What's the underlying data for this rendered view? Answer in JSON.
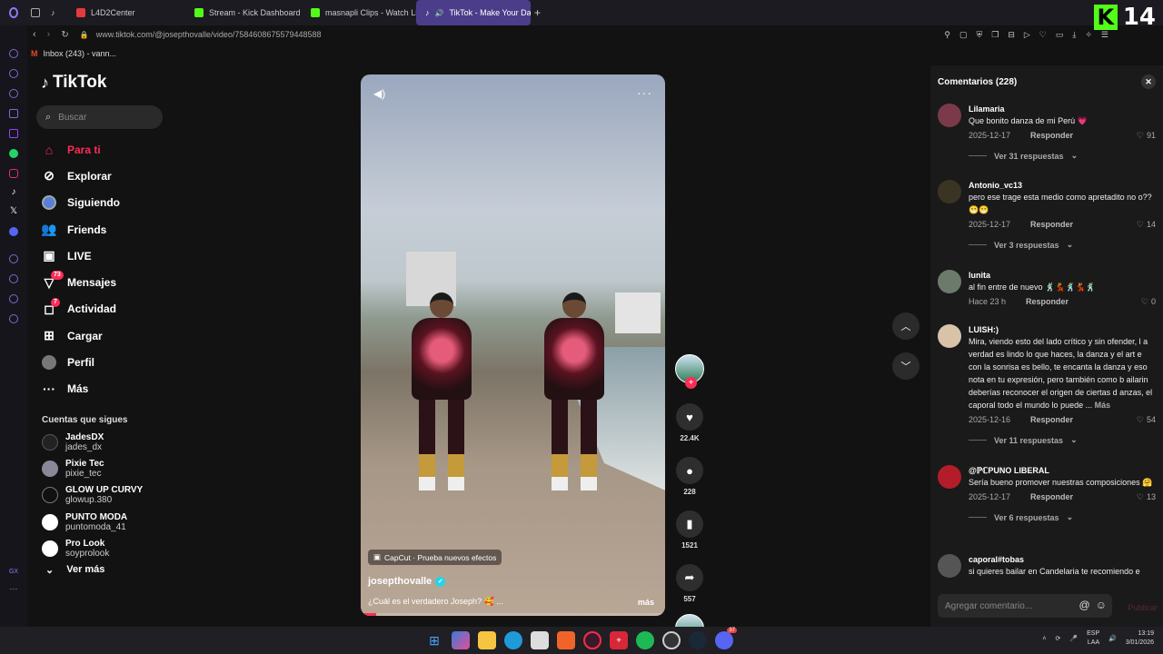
{
  "browser": {
    "tabs": [
      {
        "label": "L4D2Center",
        "color": "#e23b3b"
      },
      {
        "label": "Stream - Kick Dashboard",
        "color": "#53fc18"
      },
      {
        "label": "masnapli Clips - Watch Li...",
        "color": "#53fc18"
      },
      {
        "label": "TikTok - Make Your Da...",
        "color": "#ffffff",
        "active": true
      }
    ],
    "url": "www.tiktok.com/@josepthovalle/video/7584608675579448588",
    "bookmark": "Inbox (243) - vann..."
  },
  "overlay": {
    "kick_letter": "K",
    "count": "14"
  },
  "sidebar": {
    "logo": "TikTok",
    "search_placeholder": "Buscar",
    "nav": [
      {
        "label": "Para ti",
        "icon": "home-icon",
        "active": true
      },
      {
        "label": "Explorar",
        "icon": "compass-icon"
      },
      {
        "label": "Siguiendo",
        "icon": "following-icon"
      },
      {
        "label": "Friends",
        "icon": "friends-icon"
      },
      {
        "label": "LIVE",
        "icon": "live-icon"
      },
      {
        "label": "Mensajes",
        "icon": "messages-icon",
        "badge": "73"
      },
      {
        "label": "Actividad",
        "icon": "activity-icon",
        "badge": "7"
      },
      {
        "label": "Cargar",
        "icon": "upload-icon"
      },
      {
        "label": "Perfil",
        "icon": "profile-icon"
      },
      {
        "label": "Más",
        "icon": "more-icon"
      }
    ],
    "following_title": "Cuentas que sigues",
    "following": [
      {
        "name": "JadesDX",
        "handle": "jades_dx"
      },
      {
        "name": "Pixie Tec",
        "handle": "pixie_tec"
      },
      {
        "name": "GLOW UP CURVY",
        "handle": "glowup.380"
      },
      {
        "name": "PUNTO MODA",
        "handle": "puntomoda_41"
      },
      {
        "name": "Pro Look",
        "handle": "soyprolook"
      }
    ],
    "see_more": "Ver más"
  },
  "video": {
    "capcut": "CapCut · Prueba nuevos efectos",
    "author": "josepthovalle",
    "caption": "¿Cuál es el verdadero Joseph? 🥰 ...",
    "more": "más",
    "progress": 0.05
  },
  "actions": {
    "likes": "22.4K",
    "comments": "228",
    "saves": "1521",
    "shares": "557"
  },
  "comments": {
    "title": "Comentarios (228)",
    "reply_label": "Responder",
    "items": [
      {
        "user": "Lilamaria",
        "text": "Que bonito danza de mi Perú 💗",
        "date": "2025-12-17",
        "likes": "91",
        "replies": "Ver 31 respuestas"
      },
      {
        "user": "Antonio_vc13",
        "text": "pero ese trage esta medio como apretadito no o?? 😁😁",
        "date": "2025-12-17",
        "likes": "14",
        "replies": "Ver 3 respuestas"
      },
      {
        "user": "lunita",
        "text": "al fin entre de nuevo 🕺💃🕺💃🕺",
        "date": "Hace 23 h",
        "likes": "0",
        "replies": ""
      },
      {
        "user": "LUISH:)",
        "text": "Mira, viendo esto del lado crítico y sin ofender, l a verdad es lindo lo que haces, la danza y el art e con la sonrisa es bello, te encanta la danza y eso nota en tu expresión, pero también como b ailarin deberías reconocer el origen de ciertas d anzas, el caporal todo el mundo lo puede ...",
        "more": "Más",
        "date": "2025-12-16",
        "likes": "54",
        "replies": "Ver 11 respuestas"
      },
      {
        "user": "@ℙℂPUNO LIBERAL",
        "text": "Sería bueno promover nuestras composiciones 🤗",
        "date": "2025-12-17",
        "likes": "13",
        "replies": "Ver 6 respuestas"
      },
      {
        "user": "caporal#tobas",
        "text": "si quieres bailar en Candelaria te recomiendo e",
        "date": "",
        "likes": "",
        "replies": ""
      }
    ],
    "input_placeholder": "Agregar comentario...",
    "publish": "Publicar"
  },
  "taskbar": {
    "lang": "ESP",
    "lang2": "LAA",
    "time": "13:19",
    "date": "3/01/2026",
    "discord_badge": "37"
  }
}
